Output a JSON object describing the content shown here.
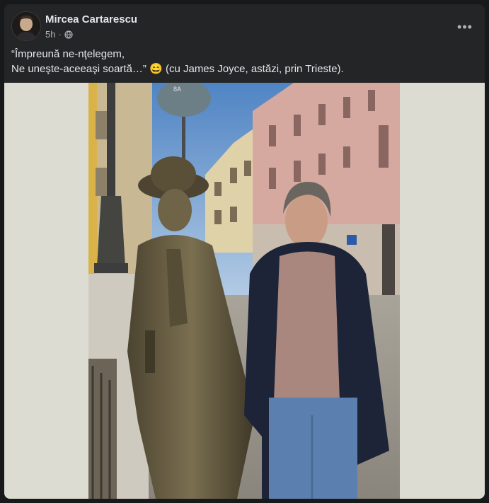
{
  "post": {
    "author": "Mircea Cartarescu",
    "time": "5h",
    "audience_icon": "globe-icon",
    "more_icon": "more-options-icon",
    "text_line1": "“Împreună ne-nţelegem,",
    "text_line2_a": "Ne uneşte-aceeaşi soartă…”",
    "emoji": "😄",
    "text_line2_b": "(cu James Joyce, astăzi, prin Trieste)."
  },
  "photo": {
    "sign_text": "8A"
  },
  "colors": {
    "card_bg": "#242526",
    "page_bg": "#18191a",
    "text_primary": "#e4e6eb",
    "text_secondary": "#b0b3b8",
    "photo_matte": "#dcdcd2"
  }
}
